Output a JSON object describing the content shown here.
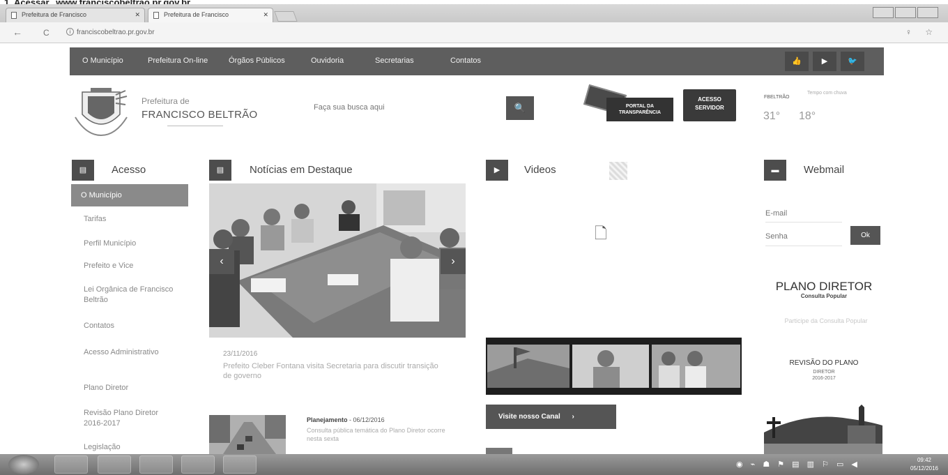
{
  "caption": {
    "text": "1. Acessar",
    "url": "www.franciscobeltrao.pr.gov.br"
  },
  "browser": {
    "tabs": [
      {
        "label": "Prefeitura de Francisco"
      },
      {
        "label": "Prefeitura de Francisco"
      }
    ],
    "address": "franciscobeltrao.pr.gov.br",
    "back_icon": "←",
    "reload_icon": "C",
    "right_icons": "♀ ☆"
  },
  "nav": {
    "items": [
      "O Município",
      "Prefeitura On-line",
      "Órgãos Públicos",
      "Ouvidoria",
      "Secretarias",
      "Contatos"
    ],
    "social": [
      "👍",
      "▶",
      "🐦"
    ]
  },
  "header": {
    "logo_small": "Prefeitura de",
    "logo_big": "FRANCISCO BELTRÃO",
    "search_placeholder": "Faça sua busca aqui",
    "search_icon": "🔍",
    "portal_line1": "PORTAL DA",
    "portal_line2": "TRANSPARÊNCIA",
    "servidor_line1": "ACESSO",
    "servidor_line2": "SERVIDOR",
    "weather_label": "FBELTRÃO",
    "weather_desc": "Tempo com chuva",
    "temp_max": "31°",
    "temp_min": "18°"
  },
  "sections": {
    "acesso": {
      "title": "Acesso",
      "icon": "▤"
    },
    "noticias": {
      "title": "Notícias em Destaque",
      "icon": "▤"
    },
    "videos": {
      "title": "Videos",
      "icon": "▶"
    },
    "webmail": {
      "title": "Webmail",
      "icon": "▬"
    }
  },
  "sidebar": {
    "active": "O Município",
    "items": [
      {
        "label": "Tarifas"
      },
      {
        "label": "Perfil Município"
      },
      {
        "label": "Prefeito e Vice"
      },
      {
        "label": "Lei Orgânica de Francisco Beltrão"
      },
      {
        "label": "Contatos"
      },
      {
        "label": "Acesso Administrativo"
      },
      {
        "label": "Plano Diretor"
      },
      {
        "label": "Revisão Plano Diretor 2016-2017"
      },
      {
        "label": "Legislação"
      }
    ]
  },
  "news": {
    "date": "23/11/2016",
    "text": "Prefeito Cleber Fontana visita Secretaria para discutir transição de governo",
    "second_category": "Planejamento",
    "second_date": "06/12/2016",
    "second_text": "Consulta pública temática do Plano Diretor ocorre nesta sexta"
  },
  "videos": {
    "button": "Visite nosso Canal",
    "arrow": "›",
    "player_icon": "🗋"
  },
  "webmail": {
    "email_placeholder": "E-mail",
    "password_placeholder": "Senha",
    "ok": "Ok",
    "plano_title": "PLANO DIRETOR",
    "plano_sub": "Consulta Popular",
    "plano_faint": "Participe da Consulta Popular",
    "revisao_title": "REVISÃO DO PLANO",
    "revisao_sub1": "DIRETOR",
    "revisao_sub2": "2016-2017"
  },
  "taskbar": {
    "tray": "◉ ⌁ ☗ ⚑ ▤ ▥ ⚐ ▭ ◀",
    "time": "09:42",
    "date": "05/12/2016"
  }
}
